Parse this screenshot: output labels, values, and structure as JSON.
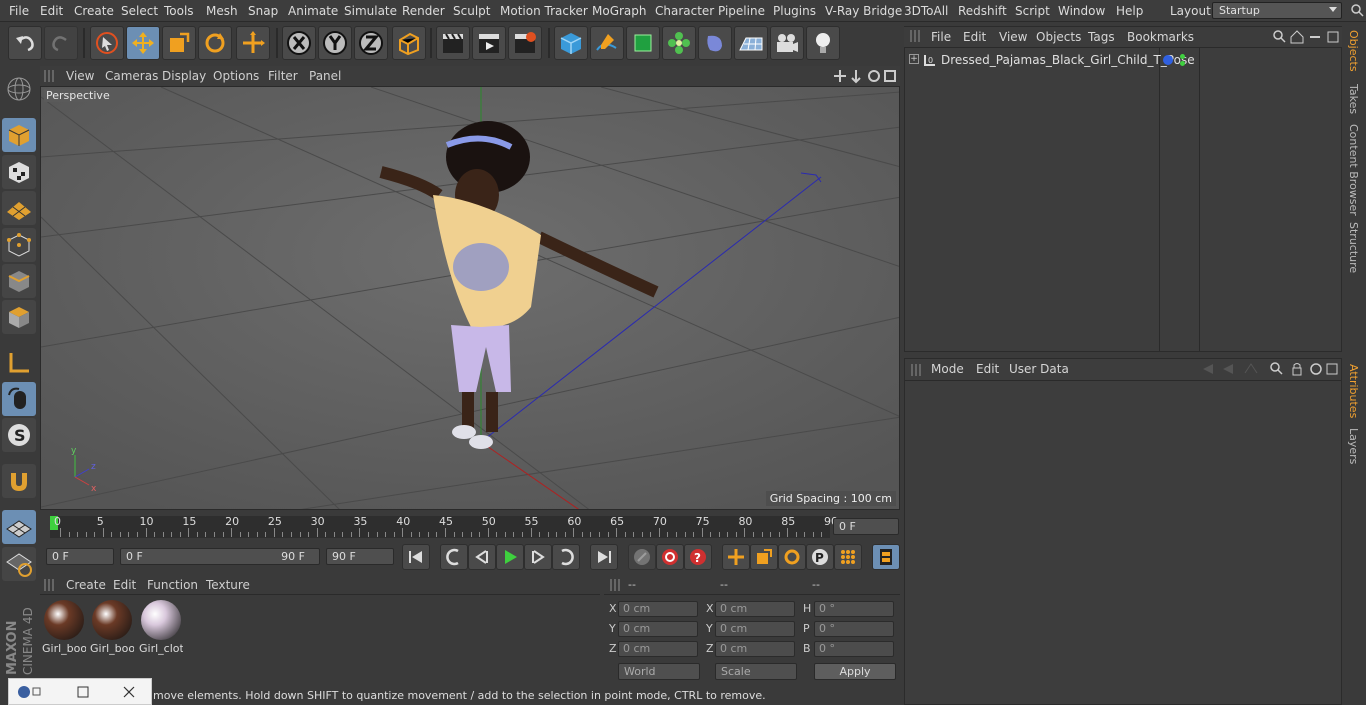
{
  "menu": [
    "File",
    "Edit",
    "Create",
    "Select",
    "Tools",
    "Mesh",
    "Snap",
    "Animate",
    "Simulate",
    "Render",
    "Sculpt",
    "Motion Tracker",
    "MoGraph",
    "Character",
    "Pipeline",
    "Plugins",
    "V-Ray Bridge",
    "3DToAll",
    "Redshift",
    "Script",
    "Window",
    "Help"
  ],
  "layout": {
    "label": "Layout:",
    "value": "Startup"
  },
  "viewport": {
    "menu": [
      "View",
      "Cameras",
      "Display",
      "Options",
      "Filter",
      "Panel"
    ],
    "label": "Perspective",
    "grid_spacing": "Grid Spacing : 100 cm"
  },
  "timeline": {
    "ticks": [
      "0",
      "5",
      "10",
      "15",
      "20",
      "25",
      "30",
      "35",
      "40",
      "45",
      "50",
      "55",
      "60",
      "65",
      "70",
      "75",
      "80",
      "85",
      "90"
    ],
    "current_frame": "0 F",
    "start": "0 F",
    "range_start": "0 F",
    "range_end": "90 F",
    "end": "90 F"
  },
  "materials": {
    "menu": [
      "Create",
      "Edit",
      "Function",
      "Texture"
    ],
    "items": [
      {
        "name": "Girl_boo",
        "color": "#6b3a26"
      },
      {
        "name": "Girl_boo",
        "color": "#6b3a26"
      },
      {
        "name": "Girl_clot",
        "color": "#d9c8dc"
      }
    ]
  },
  "coords": {
    "headers": [
      "--",
      "--",
      "--"
    ],
    "rows": [
      {
        "a": "X",
        "av": "0 cm",
        "b": "X",
        "bv": "0 cm",
        "c": "H",
        "cv": "0 °"
      },
      {
        "a": "Y",
        "av": "0 cm",
        "b": "Y",
        "bv": "0 cm",
        "c": "P",
        "cv": "0 °"
      },
      {
        "a": "Z",
        "av": "0 cm",
        "b": "Z",
        "bv": "0 cm",
        "c": "B",
        "cv": "0 °"
      }
    ],
    "world": "World",
    "scale": "Scale",
    "apply": "Apply"
  },
  "objects": {
    "menu": [
      "File",
      "Edit",
      "View",
      "Objects",
      "Tags",
      "Bookmarks"
    ],
    "items": [
      {
        "name": "Dressed_Pajamas_Black_Girl_Child_T_Pose"
      }
    ]
  },
  "attributes": {
    "menu": [
      "Mode",
      "Edit",
      "User Data"
    ]
  },
  "right_tabs": [
    "Objects",
    "Takes",
    "Content Browser",
    "Structure",
    "Attributes",
    "Layers"
  ],
  "status": "move elements. Hold down SHIFT to quantize movement / add to the selection in point mode, CTRL to remove.",
  "branding": "MAXON CINEMA 4D"
}
